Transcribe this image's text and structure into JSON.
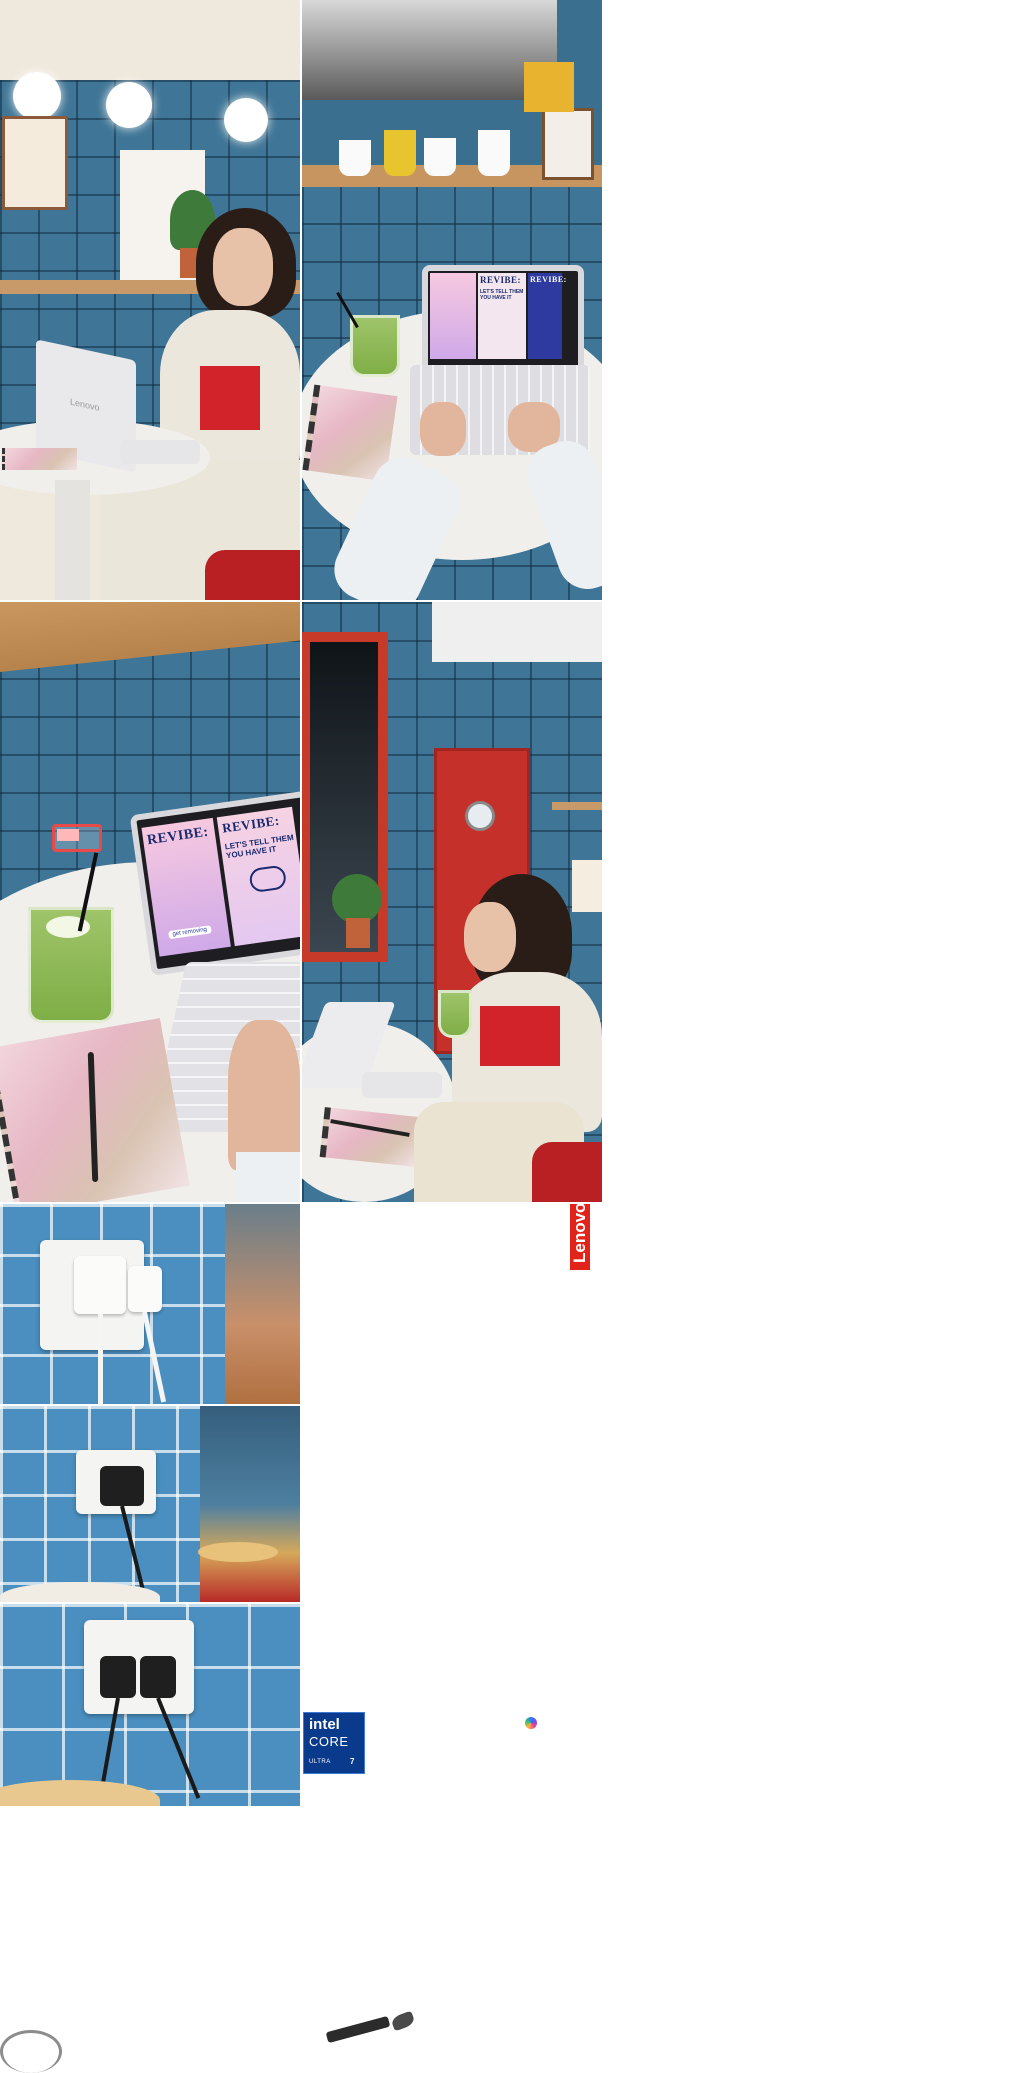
{
  "screen_texts": {
    "revibe_top": "REVIBE:",
    "revibe_top_second": "REVIBE:",
    "top_sub": "LET'S TELL THEM\nYOU HAVE IT",
    "revibe_left": "REVIBE:",
    "revibe_right": "REVIBE:",
    "tell_them": "LET'S TELL THEM\nYOU HAVE IT",
    "get_removing": "get removing"
  },
  "laptop_lid_brand": "Lenovo",
  "badges": {
    "lenovo": "Lenovo",
    "intel_brand": "intel",
    "intel_core": "CORE",
    "intel_ultra": "ULTRA",
    "intel_number": "7"
  },
  "colors": {
    "lenovo_red": "#e2231a",
    "intel_blue": "#0a3a8c",
    "tile_blue": "#3f7596",
    "top_red": "#d3232a"
  },
  "icons": [
    "battery-icon",
    "copilot-icon"
  ]
}
